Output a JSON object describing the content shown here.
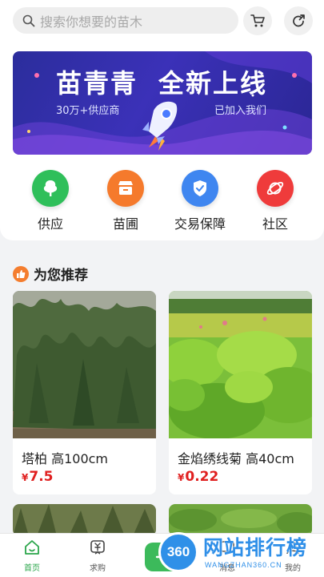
{
  "search": {
    "placeholder": "搜索你想要的苗木"
  },
  "header": {
    "cart_icon": "cart-icon",
    "share_icon": "share-icon"
  },
  "banner": {
    "title_left": "苗青青",
    "title_right": "全新上线",
    "sub_left": "30万+供应商",
    "sub_right": "已加入我们"
  },
  "categories": [
    {
      "label": "供应",
      "icon": "tree-icon",
      "color": "#2fbf5a"
    },
    {
      "label": "苗圃",
      "icon": "store-icon",
      "color": "#f57a2c"
    },
    {
      "label": "交易保障",
      "icon": "shield-check-icon",
      "color": "#3f86f0"
    },
    {
      "label": "社区",
      "icon": "planet-icon",
      "color": "#ef3b3b"
    }
  ],
  "recommend": {
    "title": "为您推荐",
    "items": [
      {
        "name": "塔柏 高100cm",
        "currency": "¥",
        "price": "7.5"
      },
      {
        "name": "金焰绣线菊 高40cm",
        "currency": "¥",
        "price": "0.22"
      }
    ]
  },
  "tabbar": {
    "items": [
      {
        "label": "首页",
        "icon": "home-icon",
        "active": true
      },
      {
        "label": "求购",
        "icon": "purchase-icon",
        "active": false
      },
      {
        "label": "消息",
        "icon": "message-icon",
        "active": false
      },
      {
        "label": "我的",
        "icon": "profile-icon",
        "active": false
      }
    ],
    "publish_icon": "plus-icon"
  },
  "watermark": {
    "logo_text": "360",
    "text": "网站排行榜",
    "url": "WANGZHAN360.CN"
  },
  "colors": {
    "accent": "#2aa54a",
    "price": "#e02020",
    "banner": "#3b31b8"
  }
}
